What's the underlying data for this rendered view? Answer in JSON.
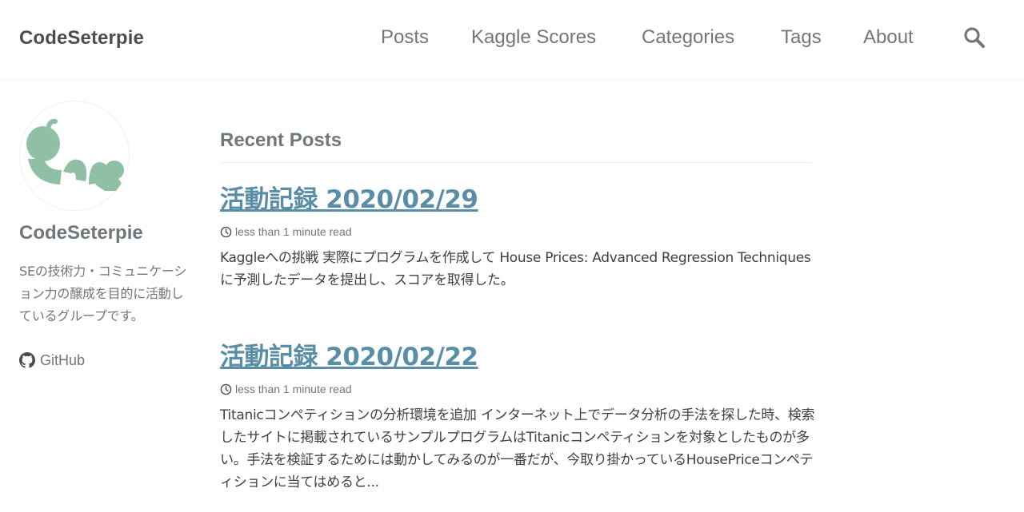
{
  "site": {
    "title": "CodeSeterpie"
  },
  "nav": {
    "items": [
      {
        "label": "Posts"
      },
      {
        "label": "Kaggle Scores"
      },
      {
        "label": "Categories"
      },
      {
        "label": "Tags"
      },
      {
        "label": "About"
      }
    ],
    "search_icon": "search-icon"
  },
  "sidebar": {
    "author_name": "CodeSeterpie",
    "bio": "SEの技術力・コミュニケーション力の醸成を目的に活動しているグループです。",
    "github_label": "GitHub",
    "avatar_color": "#8fbfa4"
  },
  "main": {
    "section_title": "Recent Posts",
    "posts": [
      {
        "title": "活動記録 2020/02/29",
        "meta": "less than 1 minute read",
        "excerpt": "Kaggleへの挑戦 実際にプログラムを作成して House Prices: Advanced Regression Techniquesに予測したデータを提出し、スコアを取得した。"
      },
      {
        "title": "活動記録 2020/02/22",
        "meta": "less than 1 minute read",
        "excerpt": "Titanicコンペティションの分析環境を追加 インターネット上でデータ分析の手法を探した時、検索したサイトに掲載されているサンプルプログラムはTitanicコンペティションを対象としたものが多い。手法を検証するためには動かしてみるのが一番だが、今取り掛かっているHousePriceコンペティションに当てはめると..."
      }
    ]
  },
  "colors": {
    "link": "#5a8ea6",
    "text": "#494e52",
    "muted": "#6f777d"
  }
}
